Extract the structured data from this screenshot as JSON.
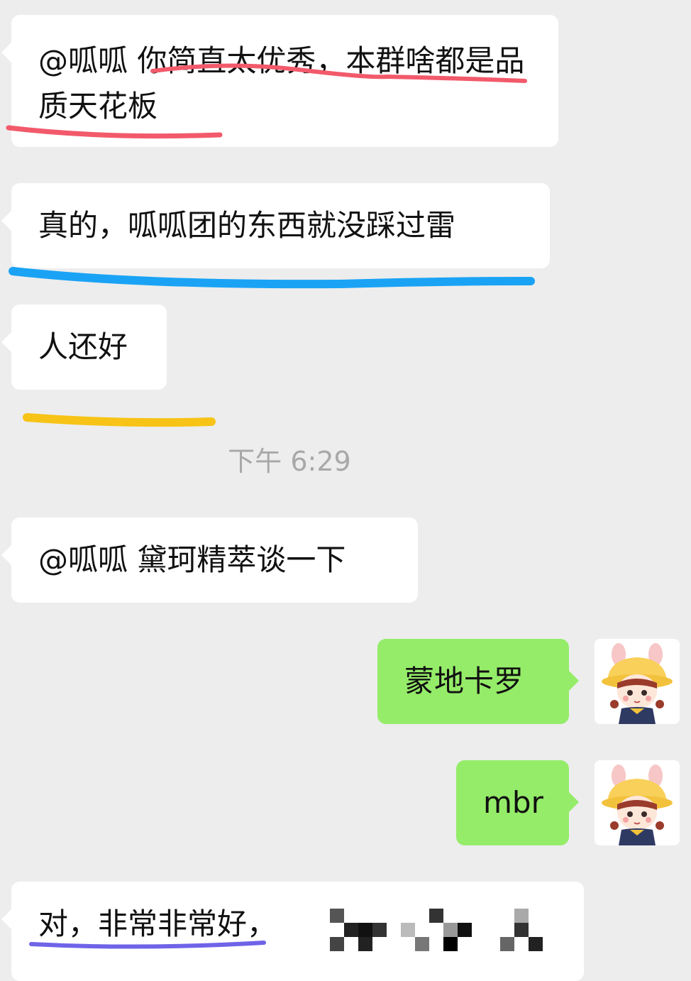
{
  "messages": [
    {
      "side": "left",
      "text": "@呱呱 你简直太优秀，本群啥都是品质天花板"
    },
    {
      "side": "left",
      "text": "真的，呱呱团的东西就没踩过雷"
    },
    {
      "side": "left",
      "text": "人还好"
    },
    {
      "side": "system",
      "text": "下午 6:29"
    },
    {
      "side": "left",
      "text": "@呱呱 黛珂精萃谈一下"
    },
    {
      "side": "right",
      "text": "蒙地卡罗"
    },
    {
      "side": "right",
      "text": "mbr"
    },
    {
      "side": "left",
      "text": "对，非常非常好，"
    }
  ],
  "highlights": {
    "red": "#f25a6b",
    "blue": "#1aa3f5",
    "yellow": "#f7c316",
    "purple": "#6f63e8"
  },
  "colors": {
    "bubble_self": "#95ec69",
    "bubble_other": "#ffffff",
    "background": "#ededed"
  },
  "icons": {
    "avatar": "cartoon-girl-yellow-hat-avatar"
  }
}
